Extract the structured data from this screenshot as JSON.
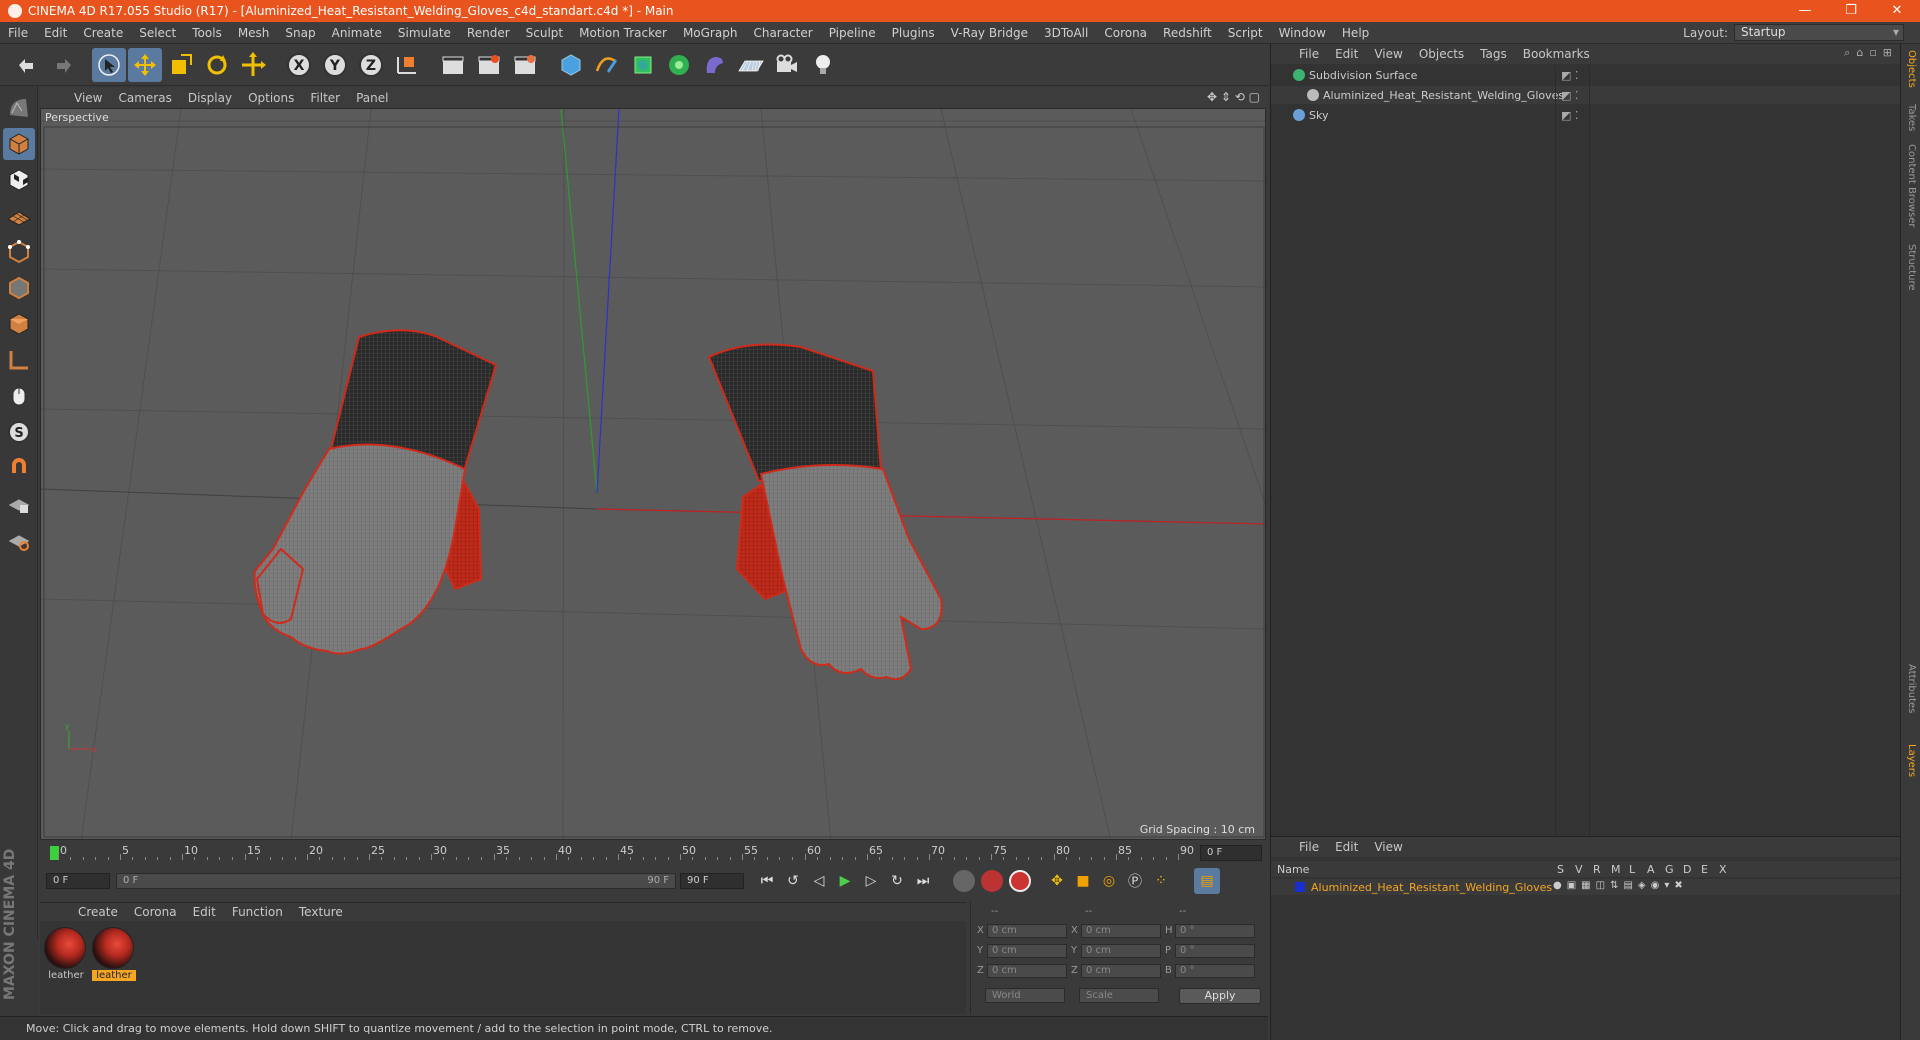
{
  "window": {
    "title": "CINEMA 4D R17.055 Studio (R17) - [Aluminized_Heat_Resistant_Welding_Gloves_c4d_standart.c4d *] - Main",
    "minimize": "—",
    "maximize": "❐",
    "close": "✕"
  },
  "menubar": [
    "File",
    "Edit",
    "Create",
    "Select",
    "Tools",
    "Mesh",
    "Snap",
    "Animate",
    "Simulate",
    "Render",
    "Sculpt",
    "Motion Tracker",
    "MoGraph",
    "Character",
    "Pipeline",
    "Plugins",
    "V-Ray Bridge",
    "3DToAll",
    "Corona",
    "Redshift",
    "Script",
    "Window",
    "Help"
  ],
  "layout": {
    "label": "Layout:",
    "value": "Startup"
  },
  "viewport": {
    "menu": [
      "View",
      "Cameras",
      "Display",
      "Options",
      "Filter",
      "Panel"
    ],
    "label": "Perspective",
    "grid_spacing": "Grid Spacing : 10 cm",
    "nav_icons": "✥ ⇕ ⟲ ▢"
  },
  "timeline": {
    "ticks": [
      "0",
      "5",
      "10",
      "15",
      "20",
      "25",
      "30",
      "35",
      "40",
      "45",
      "50",
      "55",
      "60",
      "65",
      "70",
      "75",
      "80",
      "85",
      "90"
    ],
    "current": "0 F"
  },
  "transport": {
    "start": "0 F",
    "range_start": "0 F",
    "range_end": "90 F",
    "end": "90 F"
  },
  "materials": {
    "menu": [
      "Create",
      "Corona",
      "Edit",
      "Function",
      "Texture"
    ],
    "items": [
      {
        "label": "leather",
        "selected": false
      },
      {
        "label": "leather",
        "selected": true
      }
    ]
  },
  "coords": {
    "headers": [
      "--",
      "--",
      "--"
    ],
    "rows": [
      {
        "a": "X",
        "av": "0 cm",
        "b": "X",
        "bv": "0 cm",
        "c": "H",
        "cv": "0 °"
      },
      {
        "a": "Y",
        "av": "0 cm",
        "b": "Y",
        "bv": "0 cm",
        "c": "P",
        "cv": "0 °"
      },
      {
        "a": "Z",
        "av": "0 cm",
        "b": "Z",
        "bv": "0 cm",
        "c": "B",
        "cv": "0 °"
      }
    ],
    "world": "World",
    "scale": "Scale",
    "apply": "Apply"
  },
  "status": "Move: Click and drag to move elements. Hold down SHIFT to quantize movement / add to the selection in point mode, CTRL to remove.",
  "brand": "MAXON CINEMA 4D",
  "objects": {
    "menu": [
      "File",
      "Edit",
      "View",
      "Objects",
      "Tags",
      "Bookmarks"
    ],
    "items": [
      {
        "name": "Subdivision Surface",
        "indent": 0,
        "color": "#3cb371"
      },
      {
        "name": "Aluminized_Heat_Resistant_Welding_Gloves",
        "indent": 1,
        "color": "#bbbbbb"
      },
      {
        "name": "Sky",
        "indent": 0,
        "color": "#6aa0d8"
      }
    ]
  },
  "layers": {
    "menu": [
      "File",
      "Edit",
      "View"
    ],
    "header_name": "Name",
    "columns": [
      "S",
      "V",
      "R",
      "M",
      "L",
      "A",
      "G",
      "D",
      "E",
      "X"
    ],
    "row": "Aluminized_Heat_Resistant_Welding_Gloves",
    "row_color": "#1a2fd0"
  },
  "side_tabs": [
    "Objects",
    "Takes",
    "Content Browser",
    "Structure",
    "Attributes",
    "Layers"
  ],
  "colors": {
    "accent": "#e8531e",
    "selected_tool": "#5a7aa0",
    "highlight": "#f5a623"
  }
}
